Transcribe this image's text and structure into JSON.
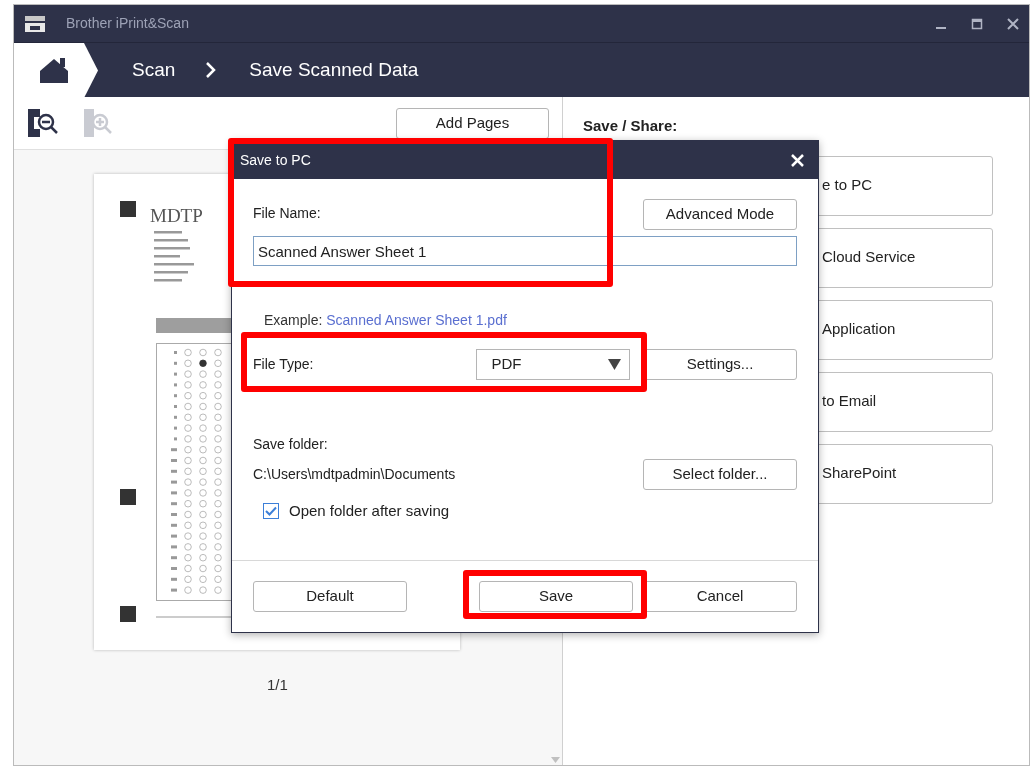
{
  "window": {
    "title": "Brother iPrint&Scan"
  },
  "breadcrumb": [
    {
      "label": "Scan"
    },
    {
      "label": "Save Scanned Data"
    }
  ],
  "toolbar": {
    "add_pages": "Add Pages"
  },
  "document": {
    "heading": "MDTP",
    "page_indicator": "1/1"
  },
  "share_panel": {
    "title": "Save / Share:",
    "options": [
      "e to PC",
      "Cloud Service",
      "Application",
      "to Email",
      "SharePoint"
    ]
  },
  "dialog": {
    "title": "Save to PC",
    "file_name_label": "File Name:",
    "advanced_mode": "Advanced Mode",
    "file_name": "Scanned Answer Sheet 1",
    "example_label": "Example:",
    "example_value": "Scanned Answer Sheet 1.pdf",
    "file_type_label": "File Type:",
    "file_type": "PDF",
    "settings": "Settings...",
    "save_folder_label": "Save folder:",
    "save_folder": "C:\\Users\\mdtpadmin\\Documents",
    "select_folder": "Select folder...",
    "open_folder": {
      "label": "Open folder after saving",
      "checked": true
    },
    "buttons": [
      "Default",
      "Save",
      "Cancel"
    ]
  }
}
